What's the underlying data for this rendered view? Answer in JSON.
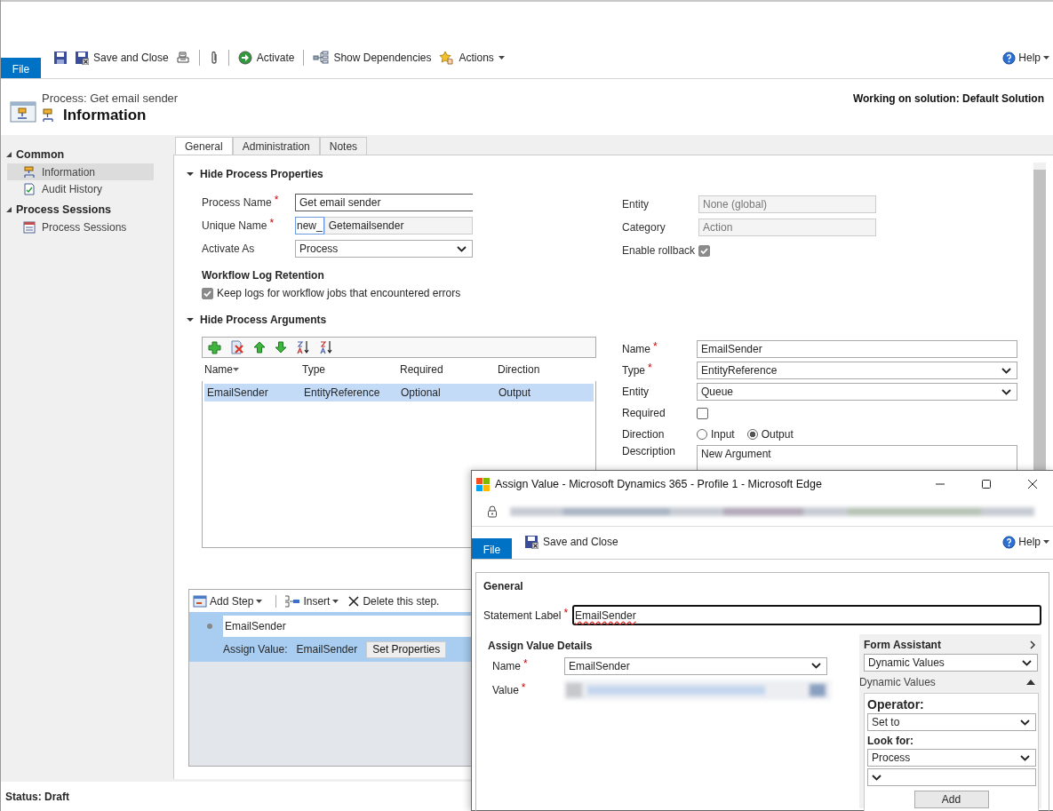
{
  "ribbon": {
    "file_tab": "File",
    "items": [
      {
        "kind": "save"
      },
      {
        "kind": "save_close",
        "label": "Save and Close"
      },
      {
        "kind": "print"
      },
      {
        "kind": "separator"
      },
      {
        "kind": "attach"
      },
      {
        "kind": "separator"
      },
      {
        "kind": "activate",
        "label": "Activate"
      },
      {
        "kind": "separator"
      },
      {
        "kind": "dependencies",
        "label": "Show Dependencies"
      },
      {
        "kind": "actions",
        "label": "Actions",
        "dropdown": true
      }
    ],
    "help": "Help"
  },
  "header": {
    "subtitle": "Process: Get email sender",
    "title": "Information",
    "solution": "Working on solution: Default Solution"
  },
  "sidebar": {
    "sections": [
      {
        "title": "Common",
        "expanded": true,
        "items": [
          {
            "label": "Information",
            "selected": true
          },
          {
            "label": "Audit History",
            "selected": false
          }
        ]
      },
      {
        "title": "Process Sessions",
        "expanded": true,
        "items": [
          {
            "label": "Process Sessions",
            "selected": false
          }
        ]
      }
    ]
  },
  "tabs": [
    {
      "label": "General",
      "selected": true
    },
    {
      "label": "Administration",
      "selected": false
    },
    {
      "label": "Notes",
      "selected": false
    }
  ],
  "properties": {
    "heading": "Hide Process Properties",
    "expanded": true,
    "fields": [
      {
        "kind": "text",
        "label": "Process Name",
        "required_mark": "*",
        "value": "Get email sender"
      },
      {
        "kind": "prefixed",
        "label": "Unique Name",
        "required_mark": "*",
        "prefix": "new_",
        "value": "Getemailsender"
      },
      {
        "kind": "select",
        "label": "Activate As",
        "value": "Process"
      }
    ],
    "log_heading": "Workflow Log Retention",
    "log_checkbox": {
      "label": "Keep logs for workflow jobs that encountered errors",
      "checked": true
    },
    "side_fields": [
      {
        "kind": "readonly",
        "label": "Entity",
        "value": "None (global)"
      },
      {
        "kind": "readonly",
        "label": "Category",
        "value": "Action"
      },
      {
        "kind": "checkbox",
        "label": "Enable rollback",
        "checked": true
      }
    ]
  },
  "arguments": {
    "heading": "Hide Process Arguments",
    "expanded": true,
    "columns": [
      {
        "label": "Name",
        "sorted": true
      },
      {
        "label": "Type",
        "sorted": false
      },
      {
        "label": "Required",
        "sorted": false
      },
      {
        "label": "Direction",
        "sorted": false
      }
    ],
    "rows": [
      {
        "cells": [
          "EmailSender",
          "EntityReference",
          "Optional",
          "Output"
        ],
        "selected": true
      }
    ],
    "detail": [
      {
        "kind": "text",
        "label": "Name",
        "required_mark": "*",
        "value": "EmailSender"
      },
      {
        "kind": "select",
        "label": "Type",
        "required_mark": "*",
        "value": "EntityReference"
      },
      {
        "kind": "select",
        "label": "Entity",
        "value": "Queue"
      },
      {
        "kind": "checkbox",
        "label": "Required",
        "checked": false
      },
      {
        "kind": "radio",
        "label": "Direction",
        "options": [
          {
            "label": "Input",
            "selected": false
          },
          {
            "label": "Output",
            "selected": true
          }
        ]
      },
      {
        "kind": "textarea",
        "label": "Description",
        "value": "New Argument"
      }
    ]
  },
  "steps": {
    "toolbar": [
      {
        "kind": "add",
        "label": "Add Step",
        "dropdown": true
      },
      {
        "kind": "insert",
        "label": "Insert",
        "dropdown": true
      },
      {
        "kind": "delete",
        "label": "Delete this step."
      }
    ],
    "items": [
      {
        "title": "EmailSender",
        "action": "Assign Value:",
        "target": "EmailSender",
        "button": "Set Properties",
        "selected": true
      }
    ]
  },
  "status_bar": "Status: Draft",
  "dialog": {
    "title": "Assign Value - Microsoft Dynamics 365 - Profile 1 - Microsoft Edge",
    "ribbon": {
      "file_tab": "File",
      "save_close": "Save and Close",
      "help": "Help"
    },
    "section": "General",
    "statement": {
      "label": "Statement Label",
      "required_mark": "*",
      "value": "EmailSender",
      "spellcheck_error": true
    },
    "details_heading": "Assign Value Details",
    "fields": [
      {
        "kind": "select",
        "label": "Name",
        "required_mark": "*",
        "value": "EmailSender"
      },
      {
        "kind": "redacted",
        "label": "Value",
        "required_mark": "*"
      }
    ],
    "assistant": {
      "title": "Form Assistant",
      "mode": "Dynamic Values",
      "group": "Dynamic Values",
      "expanded": true,
      "operator_label": "Operator:",
      "operator": "Set to",
      "look_for_label": "Look for:",
      "look_for": "Process",
      "add": "Add"
    }
  }
}
